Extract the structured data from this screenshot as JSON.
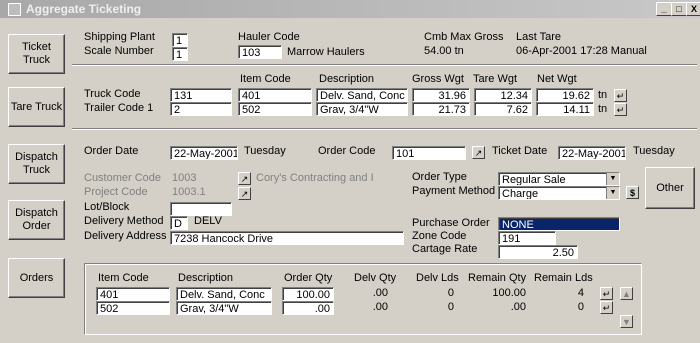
{
  "window": {
    "title": "Aggregate Ticketing",
    "minimize": "_",
    "maximize": "□",
    "close": "X"
  },
  "nav": [
    "Ticket Truck",
    "Tare Truck",
    "Dispatch Truck",
    "Dispatch Order",
    "Orders"
  ],
  "header": {
    "shipping_plant_label": "Shipping Plant",
    "shipping_plant": "1",
    "scale_number_label": "Scale Number",
    "scale_number": "1",
    "hauler_code_label": "Hauler Code",
    "hauler_code": "103",
    "hauler_name": "Marrow Haulers",
    "cmb_max_gross_label": "Cmb Max Gross",
    "cmb_max_gross": "54.00 tn",
    "last_tare_label": "Last Tare",
    "last_tare": "06-Apr-2001 17:28  Manual"
  },
  "truck": {
    "truck_code_label": "Truck Code",
    "truck_code": "131",
    "trailer_code_label": "Trailer Code 1",
    "trailer_code": "2",
    "col_item_code": "Item Code",
    "col_description": "Description",
    "col_gross": "Gross Wgt",
    "col_tare": "Tare Wgt",
    "col_net": "Net Wgt",
    "rows": [
      {
        "item": "401",
        "desc": "Delv. Sand, Conc",
        "gross": "31.96",
        "tare": "12.34",
        "net": "19.62",
        "unit": "tn"
      },
      {
        "item": "502",
        "desc": "Grav, 3/4\"W",
        "gross": "21.73",
        "tare": "7.62",
        "net": "14.11",
        "unit": "tn"
      }
    ]
  },
  "order": {
    "order_date_label": "Order Date",
    "order_date": "22-May-2001",
    "order_day": "Tuesday",
    "order_code_label": "Order Code",
    "order_code": "101",
    "ticket_date_label": "Ticket Date",
    "ticket_date": "22-May-2001",
    "ticket_day": "Tuesday",
    "customer_code_label": "Customer Code",
    "customer_code": "1003",
    "customer_name": "Cory's Contracting and I",
    "project_code_label": "Project Code",
    "project_code": "1003.1",
    "lot_block_label": "Lot/Block",
    "lot_block": "",
    "delivery_method_label": "Delivery Method",
    "delivery_method": "D",
    "delivery_method_desc": "DELV",
    "delivery_address_label": "Delivery Address",
    "delivery_address": "7238 Hancock Drive",
    "order_type_label": "Order Type",
    "order_type": "Regular Sale",
    "payment_method_label": "Payment Method",
    "payment_method": "Charge",
    "dollar_button": "$",
    "other_button": "Other",
    "purchase_order_label": "Purchase Order",
    "purchase_order": "NONE",
    "zone_code_label": "Zone Code",
    "zone_code": "191",
    "cartage_rate_label": "Cartage Rate",
    "cartage_rate": "2.50"
  },
  "items": {
    "headers": [
      "Item Code",
      "Description",
      "Order Qty",
      "Delv Qty",
      "Delv Lds",
      "Remain Qty",
      "Remain Lds"
    ],
    "rows": [
      {
        "item": "401",
        "desc": "Delv. Sand, Conc",
        "order_qty": "100.00",
        "delv_qty": ".00",
        "delv_lds": "0",
        "remain_qty": "100.00",
        "remain_lds": "4"
      },
      {
        "item": "502",
        "desc": "Grav, 3/4\"W",
        "order_qty": ".00",
        "delv_qty": ".00",
        "delv_lds": "0",
        "remain_qty": ".00",
        "remain_lds": "0"
      }
    ]
  },
  "icons": {
    "return": "↵",
    "browse": "↗",
    "dropdown": "▼",
    "scroll_up": "▲",
    "scroll_down": "▼"
  }
}
